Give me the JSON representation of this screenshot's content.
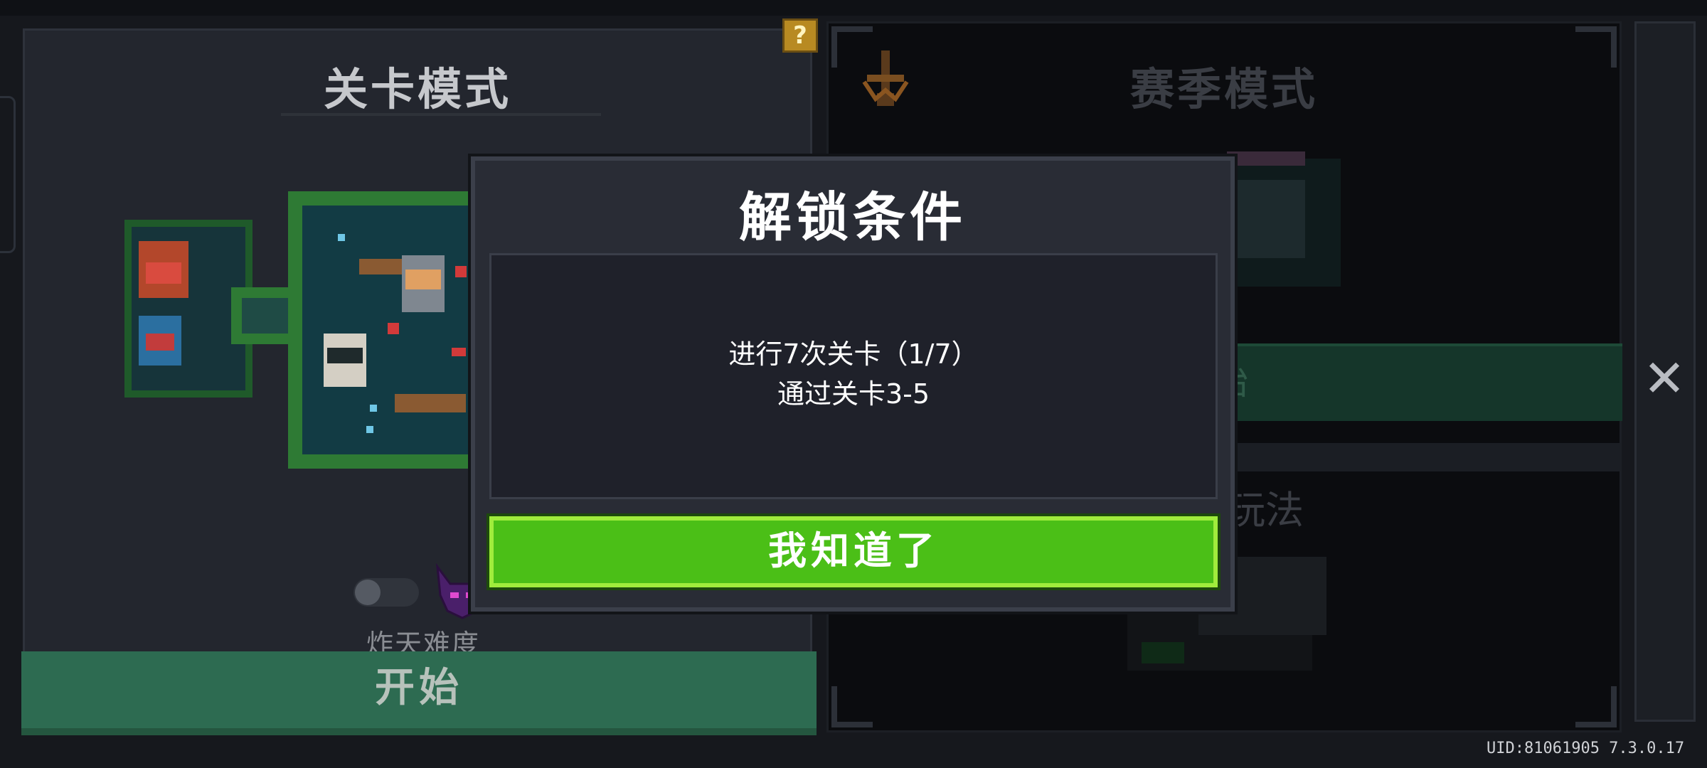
{
  "level_mode": {
    "title": "关卡模式",
    "help_icon": "?",
    "hard_mode_label": "炸天难度",
    "hard_mode_enabled": false,
    "start_label": "开始"
  },
  "season_mode": {
    "title": "赛季模式",
    "start_label": "始",
    "other_title": "玩法"
  },
  "modal": {
    "title": "解锁条件",
    "conditions": [
      "进行7次关卡（1/7）",
      "通过关卡3-5"
    ],
    "confirm_label": "我知道了"
  },
  "close_icon": "✕",
  "footer": {
    "uid": "UID:81061905 7.3.0.17"
  },
  "colors": {
    "start_green": "#2d6b51",
    "confirm_green": "#4bbf17",
    "confirm_border": "#a0ec3c",
    "panel_bg": "#23262e",
    "modal_bg": "#292c35"
  }
}
